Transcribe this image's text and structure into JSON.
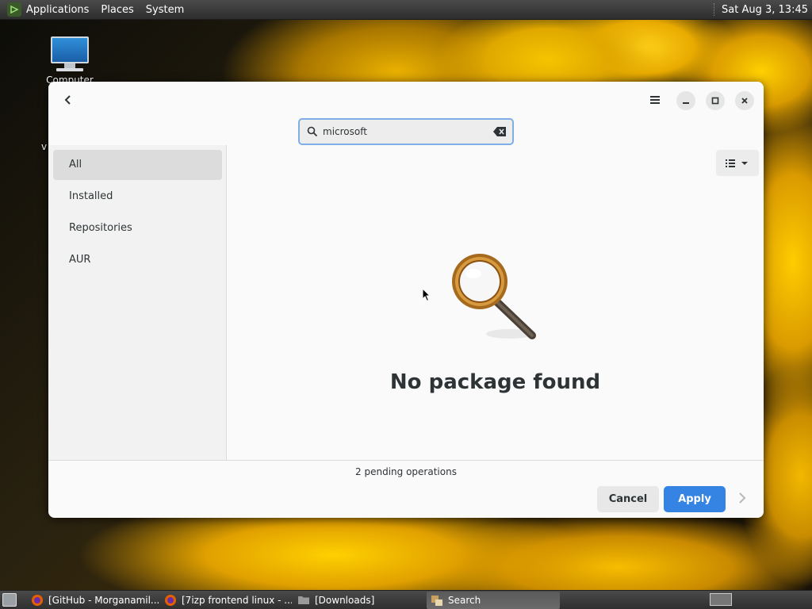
{
  "colors": {
    "accent": "#3584e4",
    "search_focus": "#7faee6",
    "panel_bg": "#2e2e2e",
    "window_bg": "#fafafa"
  },
  "top_panel": {
    "menus": [
      "Applications",
      "Places",
      "System"
    ],
    "clock": "Sat Aug 3, 13:45"
  },
  "desktop": {
    "icon_label": "Computer",
    "stray_label": "v"
  },
  "window": {
    "search": {
      "value": "microsoft",
      "icon": "search-icon",
      "clear_icon": "backspace-icon"
    },
    "header_icons": [
      "back-arrow-icon",
      "hamburger-menu-icon",
      "minimize-icon",
      "maximize-icon",
      "close-icon"
    ],
    "sidebar": {
      "items": [
        {
          "label": "All",
          "active": true
        },
        {
          "label": "Installed",
          "active": false
        },
        {
          "label": "Repositories",
          "active": false
        },
        {
          "label": "AUR",
          "active": false
        }
      ]
    },
    "content": {
      "empty_title": "No package found",
      "empty_icon": "magnifier-icon",
      "view_icon": "list-view-icon"
    },
    "footer": {
      "pending": "2 pending operations",
      "cancel_label": "Cancel",
      "apply_label": "Apply"
    }
  },
  "taskbar": {
    "tasks": [
      {
        "label": "[GitHub - Morganamil...",
        "icon": "firefox-icon",
        "active": false
      },
      {
        "label": "[7izp frontend linux - ...",
        "icon": "firefox-icon",
        "active": false
      },
      {
        "label": "[Downloads]",
        "icon": "folder-icon",
        "active": false
      },
      {
        "label": "Search",
        "icon": "package-search-icon",
        "active": true
      }
    ]
  }
}
